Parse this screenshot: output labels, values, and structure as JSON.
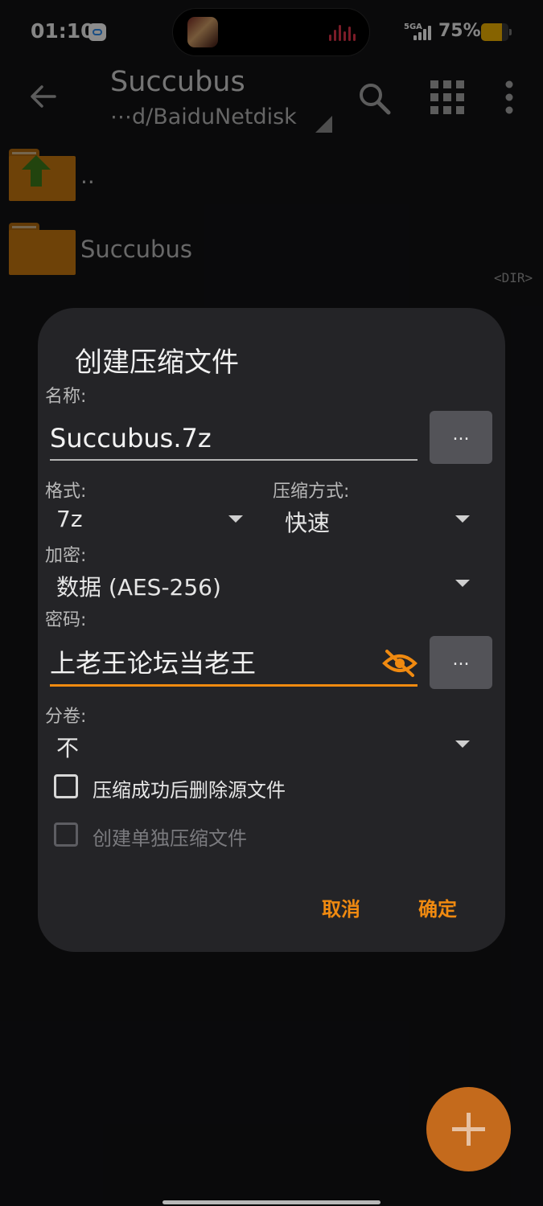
{
  "status_bar": {
    "time": "01:10",
    "network": "5GA",
    "battery_text": "75%",
    "battery_level": 0.75
  },
  "toolbar": {
    "title": "Succubus",
    "path": "⋯d/BaiduNetdisk"
  },
  "file_list": {
    "parent_label": "..",
    "items": [
      {
        "name": "Succubus",
        "type": "<DIR>"
      }
    ]
  },
  "dialog": {
    "title": "创建压缩文件",
    "name_label": "名称:",
    "name_value": "Succubus.7z",
    "browse_label": "...",
    "format_label": "格式:",
    "format_value": "7z",
    "method_label": "压缩方式:",
    "method_value": "快速",
    "encryption_label": "加密:",
    "encryption_value": "数据 (AES-256)",
    "password_label": "密码:",
    "password_value": "上老王论坛当老王",
    "split_label": "分卷:",
    "split_value": "不",
    "delete_source_label": "压缩成功后删除源文件",
    "separate_archives_label": "创建单独压缩文件",
    "cancel_label": "取消",
    "ok_label": "确定"
  },
  "colors": {
    "accent": "#f08a10",
    "dialog_bg": "#242427",
    "fab": "#c46a1c"
  }
}
